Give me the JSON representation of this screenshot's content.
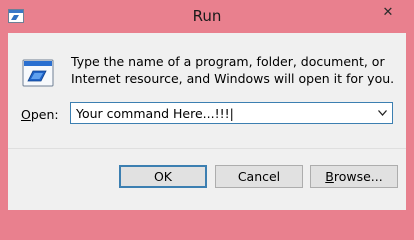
{
  "window": {
    "title": "Run",
    "close_glyph": "✕"
  },
  "dialog": {
    "description": "Type the name of a program, folder, document, or Internet resource, and Windows will open it for you.",
    "open_label_accel": "O",
    "open_label_rest": "pen:",
    "input_value": "Your command Here...!!!|",
    "dropdown_icon": "chevron-down-icon"
  },
  "buttons": {
    "ok": "OK",
    "cancel": "Cancel",
    "browse_accel": "B",
    "browse_rest": "rowse..."
  },
  "colors": {
    "frame": "#e9808e",
    "client": "#f0f0f0",
    "focus_border": "#3c7fb1"
  }
}
